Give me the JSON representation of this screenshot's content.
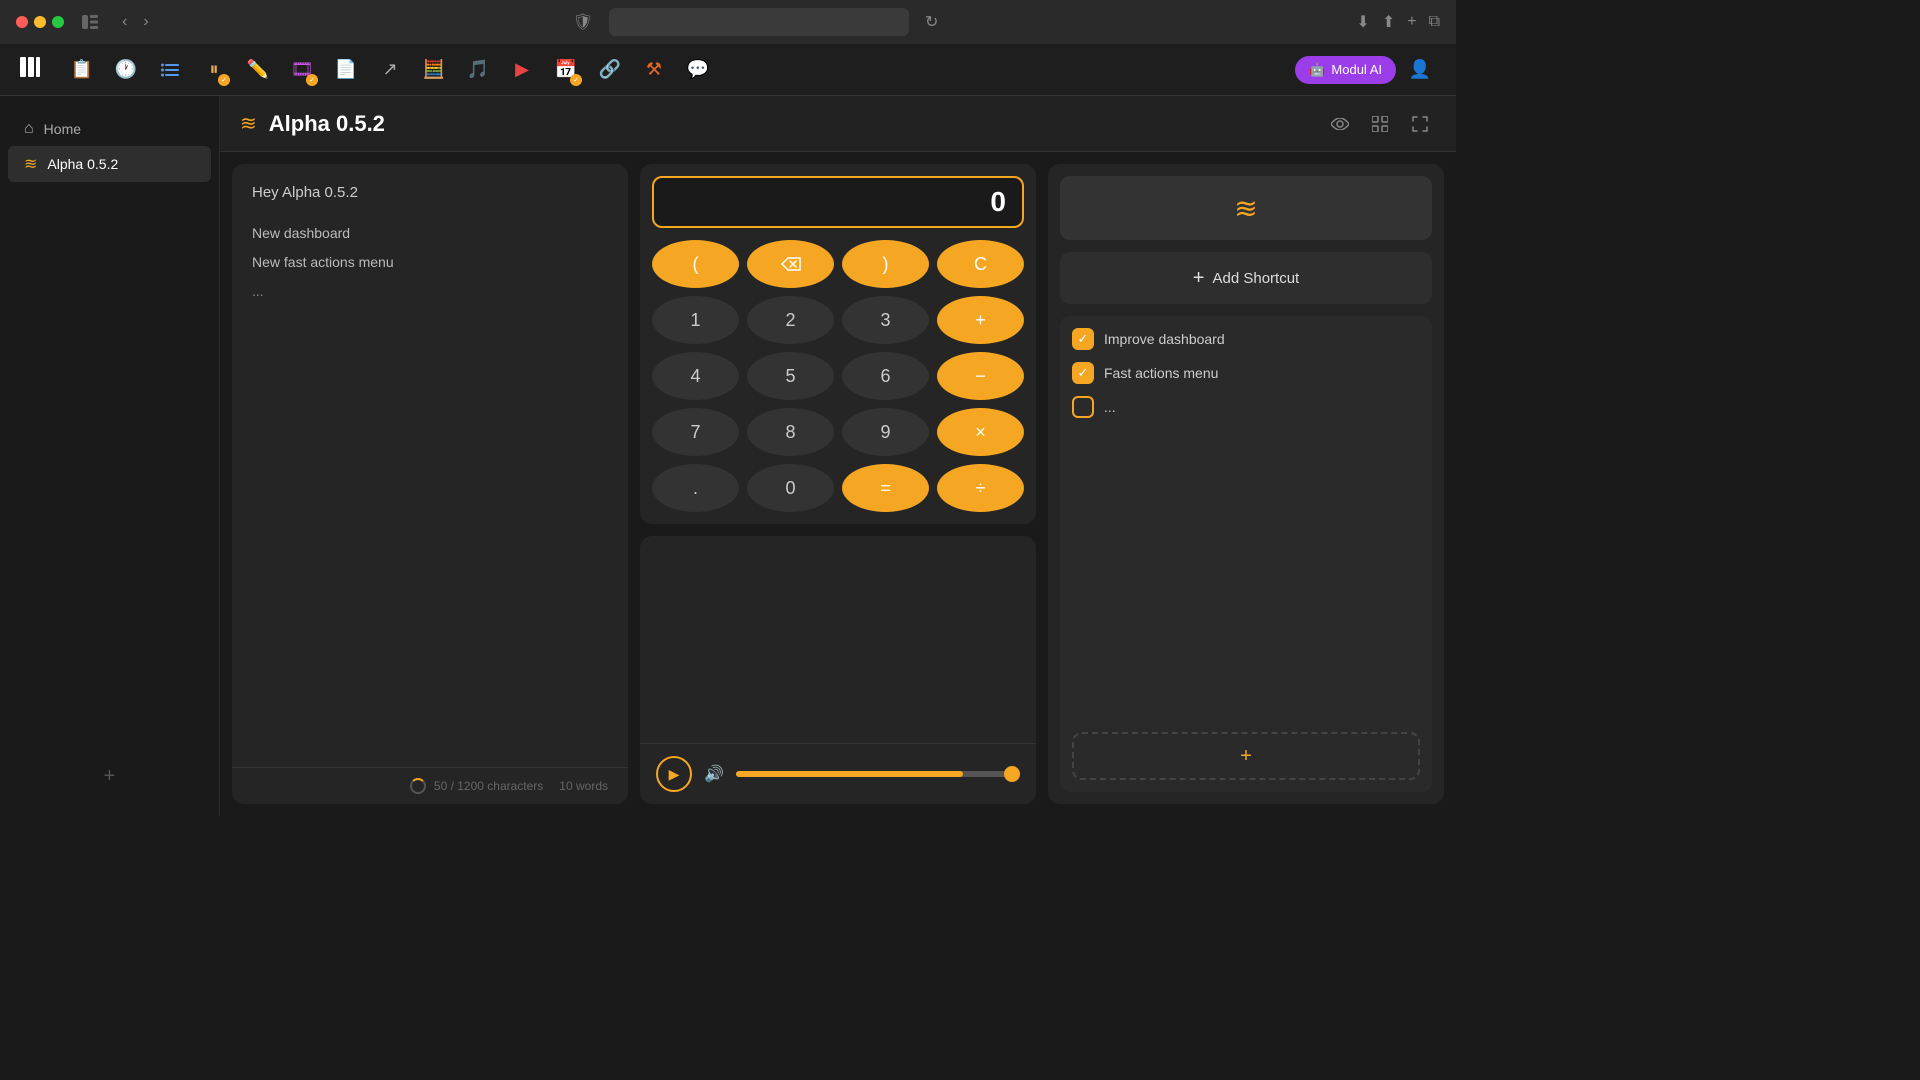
{
  "titlebar": {
    "nav_back": "‹",
    "nav_forward": "›"
  },
  "toolbar": {
    "logo": "▮▮▮",
    "items": [
      {
        "name": "clipboard",
        "icon": "📋",
        "badge": false,
        "color": "#e8b84b"
      },
      {
        "name": "clock",
        "icon": "🕐",
        "badge": false,
        "color": "#e85555"
      },
      {
        "name": "list",
        "icon": "☰",
        "badge": false,
        "color": "#5599e8"
      },
      {
        "name": "pause",
        "icon": "⏸",
        "badge": true,
        "color": "#e8a855"
      },
      {
        "name": "edit",
        "icon": "✏️",
        "badge": false,
        "color": "#aaa"
      },
      {
        "name": "film",
        "icon": "🎞",
        "badge": true,
        "color": "#cc55e8"
      },
      {
        "name": "document",
        "icon": "📄",
        "badge": false,
        "color": "#aaa"
      },
      {
        "name": "external",
        "icon": "↗",
        "badge": false,
        "color": "#aaa"
      },
      {
        "name": "calculator",
        "icon": "🧮",
        "badge": false,
        "color": "#e84444"
      },
      {
        "name": "music",
        "icon": "🎵",
        "badge": false,
        "color": "#5577ee"
      },
      {
        "name": "video",
        "icon": "▶",
        "badge": false,
        "color": "#e84444"
      },
      {
        "name": "calendar",
        "icon": "📅",
        "badge": true,
        "color": "#e8a855"
      },
      {
        "name": "link",
        "icon": "🔗",
        "badge": false,
        "color": "#55bb55"
      },
      {
        "name": "tools",
        "icon": "⚒",
        "badge": false,
        "color": "#e86622"
      },
      {
        "name": "chat",
        "icon": "💬",
        "badge": false,
        "color": "#55cc88"
      }
    ],
    "modul_label": "Modul AI",
    "user_icon": "👤"
  },
  "sidebar": {
    "items": [
      {
        "id": "home",
        "label": "Home",
        "icon": "⌂"
      },
      {
        "id": "alpha",
        "label": "Alpha 0.5.2",
        "icon": "≋",
        "active": true
      }
    ],
    "add_label": "+"
  },
  "page": {
    "icon": "≋",
    "title": "Alpha 0.5.2"
  },
  "left_panel": {
    "greeting": "Hey Alpha 0.5.2",
    "items": [
      "New dashboard",
      "New fast actions menu",
      "..."
    ],
    "char_count": "50 / 1200 characters",
    "word_count": "10 words"
  },
  "calculator": {
    "display": "0",
    "buttons": [
      {
        "label": "(",
        "type": "orange"
      },
      {
        "label": "⌫",
        "type": "orange-back"
      },
      {
        "label": ")",
        "type": "orange"
      },
      {
        "label": "C",
        "type": "orange"
      },
      {
        "label": "1",
        "type": "dark"
      },
      {
        "label": "2",
        "type": "dark"
      },
      {
        "label": "3",
        "type": "dark"
      },
      {
        "label": "+",
        "type": "orange"
      },
      {
        "label": "4",
        "type": "dark"
      },
      {
        "label": "5",
        "type": "dark"
      },
      {
        "label": "6",
        "type": "dark"
      },
      {
        "label": "−",
        "type": "orange"
      },
      {
        "label": "7",
        "type": "dark"
      },
      {
        "label": "8",
        "type": "dark"
      },
      {
        "label": "9",
        "type": "dark"
      },
      {
        "label": "×",
        "type": "orange"
      },
      {
        "label": ".",
        "type": "dark"
      },
      {
        "label": "0",
        "type": "dark"
      },
      {
        "label": "=",
        "type": "orange"
      },
      {
        "label": "÷",
        "type": "orange"
      }
    ]
  },
  "shortcuts": {
    "add_label": "Add Shortcut",
    "todo_items": [
      {
        "label": "Improve dashboard",
        "done": true
      },
      {
        "label": "Fast actions menu",
        "done": true
      },
      {
        "label": "...",
        "done": false
      }
    ]
  },
  "audio": {
    "volume_pct": 80
  }
}
